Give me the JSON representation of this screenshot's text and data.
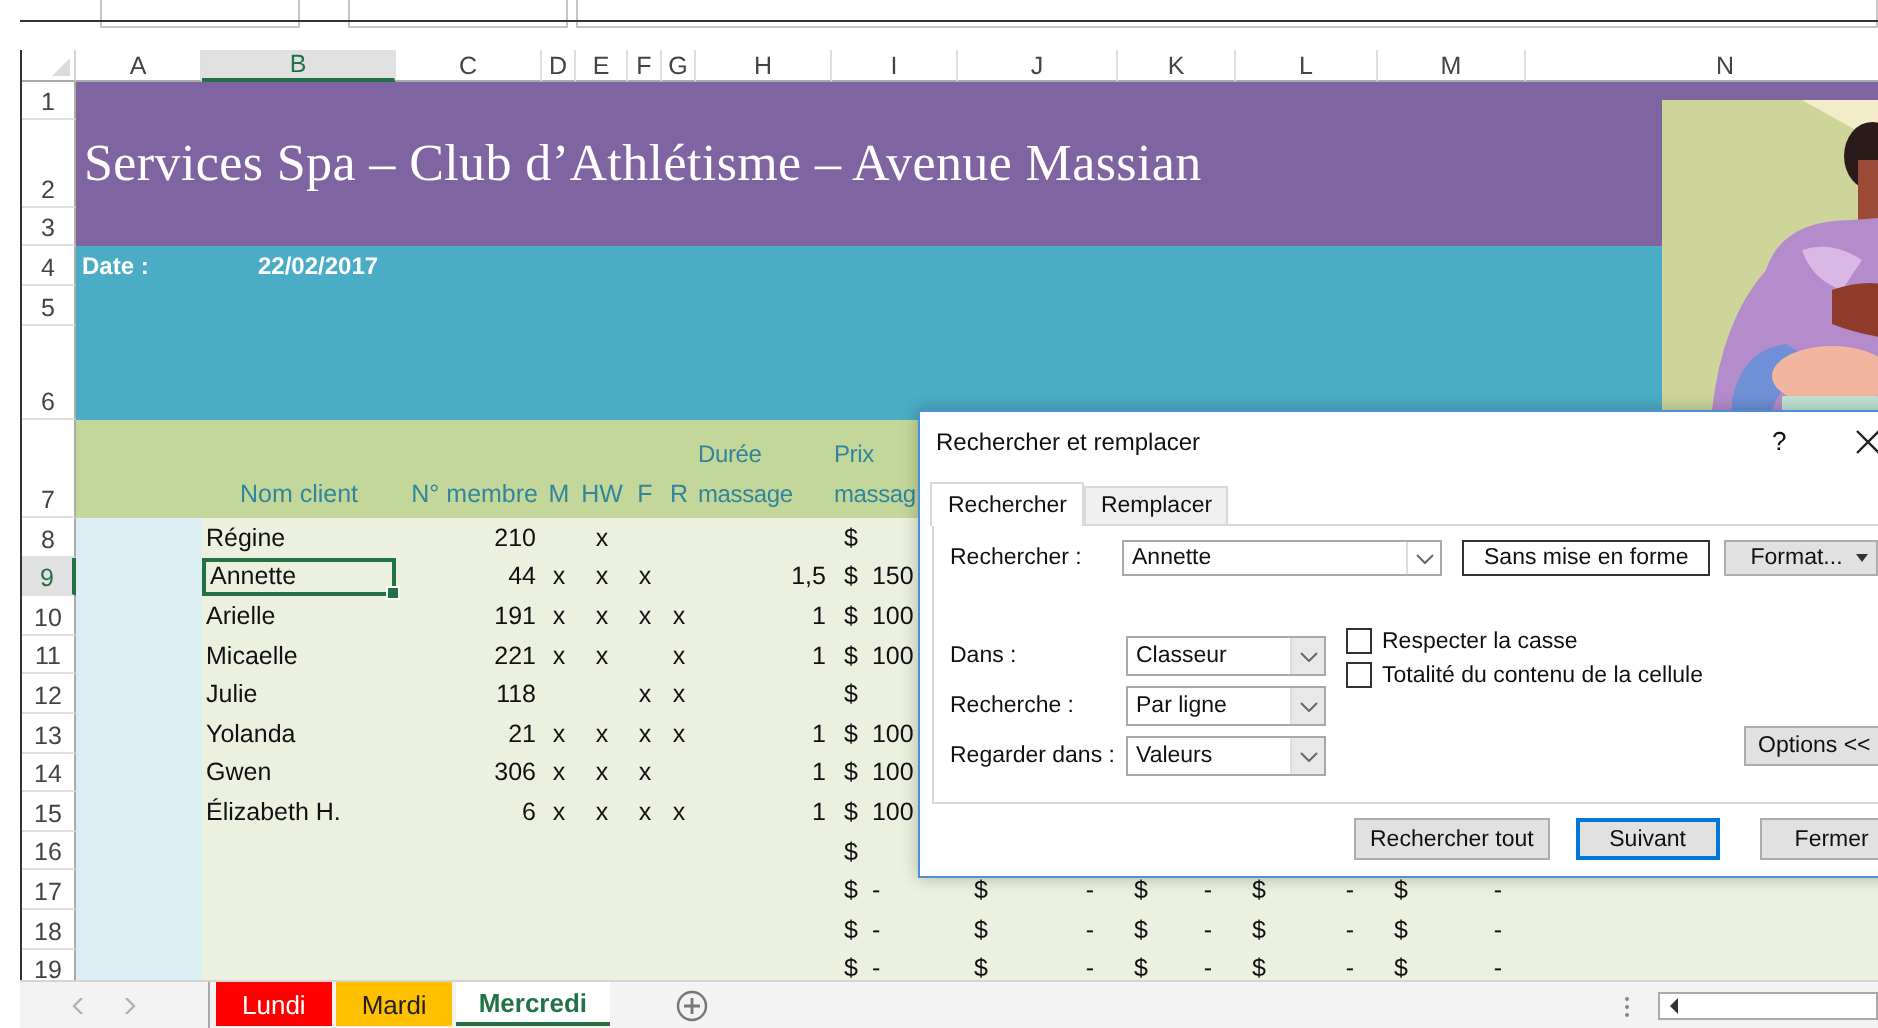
{
  "columns": [
    {
      "label": "A",
      "selected": false
    },
    {
      "label": "B",
      "selected": true
    },
    {
      "label": "C",
      "selected": false
    },
    {
      "label": "D",
      "selected": false
    },
    {
      "label": "E",
      "selected": false
    },
    {
      "label": "F",
      "selected": false
    },
    {
      "label": "G",
      "selected": false
    },
    {
      "label": "H",
      "selected": false
    },
    {
      "label": "I",
      "selected": false
    },
    {
      "label": "J",
      "selected": false
    },
    {
      "label": "K",
      "selected": false
    },
    {
      "label": "L",
      "selected": false
    },
    {
      "label": "M",
      "selected": false
    },
    {
      "label": "N",
      "selected": false
    }
  ],
  "banner_rows": [
    {
      "number": "1",
      "selected": false
    },
    {
      "number": "2",
      "selected": false
    },
    {
      "number": "3",
      "selected": false
    },
    {
      "number": "4",
      "selected": false
    },
    {
      "number": "5",
      "selected": false
    },
    {
      "number": "6",
      "selected": false
    },
    {
      "number": "7",
      "selected": false
    }
  ],
  "title": "Services Spa – Club d’Athlétisme – Avenue Massian",
  "date_label": "Date :",
  "date_value": "22/02/2017",
  "header_cells": {
    "name": "Nom client",
    "member": "N° membre",
    "m": "M",
    "hw": "HW",
    "f": "F",
    "r": "R",
    "duration": "Durée massage",
    "price": "Prix massag"
  },
  "data_rows": [
    {
      "number": "8",
      "selected": false,
      "cells": {
        "name": "Régine",
        "member": "210",
        "hw": "x",
        "price": [
          "$"
        ]
      }
    },
    {
      "number": "9",
      "selected": true,
      "cells": {
        "name": "Annette",
        "member": "44",
        "m": "x",
        "hw": "x",
        "f": "x",
        "duration": "1,5",
        "price": [
          "$",
          "150"
        ]
      }
    },
    {
      "number": "10",
      "selected": false,
      "cells": {
        "name": "Arielle",
        "member": "191",
        "m": "x",
        "hw": "x",
        "f": "x",
        "r": "x",
        "duration": "1",
        "price": [
          "$",
          "100"
        ]
      }
    },
    {
      "number": "11",
      "selected": false,
      "cells": {
        "name": "Micaelle",
        "member": "221",
        "m": "x",
        "hw": "x",
        "r": "x",
        "duration": "1",
        "price": [
          "$",
          "100"
        ]
      }
    },
    {
      "number": "12",
      "selected": false,
      "cells": {
        "name": "Julie",
        "member": "118",
        "f": "x",
        "r": "x",
        "price": [
          "$"
        ]
      }
    },
    {
      "number": "13",
      "selected": false,
      "cells": {
        "name": "Yolanda",
        "member": "21",
        "m": "x",
        "hw": "x",
        "f": "x",
        "r": "x",
        "duration": "1",
        "price": [
          "$",
          "100"
        ]
      }
    },
    {
      "number": "14",
      "selected": false,
      "cells": {
        "name": "Gwen",
        "member": "306",
        "m": "x",
        "hw": "x",
        "f": "x",
        "duration": "1",
        "price": [
          "$",
          "100"
        ]
      }
    },
    {
      "number": "15",
      "selected": false,
      "cells": {
        "name": "Élizabeth H.",
        "member": "6",
        "m": "x",
        "hw": "x",
        "f": "x",
        "r": "x",
        "duration": "1",
        "price": [
          "$",
          "100"
        ]
      }
    },
    {
      "number": "16",
      "selected": false,
      "cells": {
        "price": [
          "$"
        ]
      }
    },
    {
      "number": "17",
      "selected": false,
      "cells": {
        "price": [
          "$",
          "-"
        ],
        "column_j": [
          "$",
          "-"
        ],
        "column_k": [
          "$",
          "-"
        ],
        "column_l": [
          "$",
          "-"
        ],
        "column_m": [
          "$",
          "-"
        ]
      }
    },
    {
      "number": "18",
      "selected": false,
      "cells": {
        "price": [
          "$",
          "-"
        ],
        "column_j": [
          "$",
          "-"
        ],
        "column_k": [
          "$",
          "-"
        ],
        "column_l": [
          "$",
          "-"
        ],
        "column_m": [
          "$",
          "-"
        ]
      }
    },
    {
      "number": "19",
      "selected": false,
      "cells": {
        "price": [
          "$",
          "-"
        ],
        "column_j": [
          "$",
          "-"
        ],
        "column_k": [
          "$",
          "-"
        ],
        "column_l": [
          "$",
          "-"
        ],
        "column_m": [
          "$",
          "-"
        ]
      }
    }
  ],
  "sheets": [
    {
      "label": "Lundi",
      "color": "#ff0000",
      "selected": false
    },
    {
      "label": "Mardi",
      "color": "#ffc000",
      "selected": false
    },
    {
      "label": "Mercredi",
      "color": "#ffffff",
      "selected": true
    }
  ],
  "dialog": {
    "title": "Rechercher et remplacer",
    "help": "?",
    "tabs": [
      {
        "label": "Rechercher",
        "selected": true
      },
      {
        "label": "Remplacer",
        "selected": false
      }
    ],
    "find": {
      "label": "Rechercher :",
      "value": "Annette"
    },
    "format_preview": "Sans mise en forme",
    "format_button": "Format...",
    "options": [
      {
        "label": "Dans :",
        "value": "Classeur"
      },
      {
        "label": "Recherche :",
        "value": "Par ligne"
      },
      {
        "label": "Regarder dans :",
        "value": "Valeurs"
      }
    ],
    "checkboxes": [
      {
        "label": "Respecter la casse",
        "checked": false
      },
      {
        "label": "Totalité du contenu de la cellule",
        "checked": false
      }
    ],
    "options_button": "Options <<",
    "buttons": [
      {
        "label": "Rechercher tout",
        "default": false
      },
      {
        "label": "Suivant",
        "default": true
      },
      {
        "label": "Fermer",
        "default": false
      }
    ]
  }
}
